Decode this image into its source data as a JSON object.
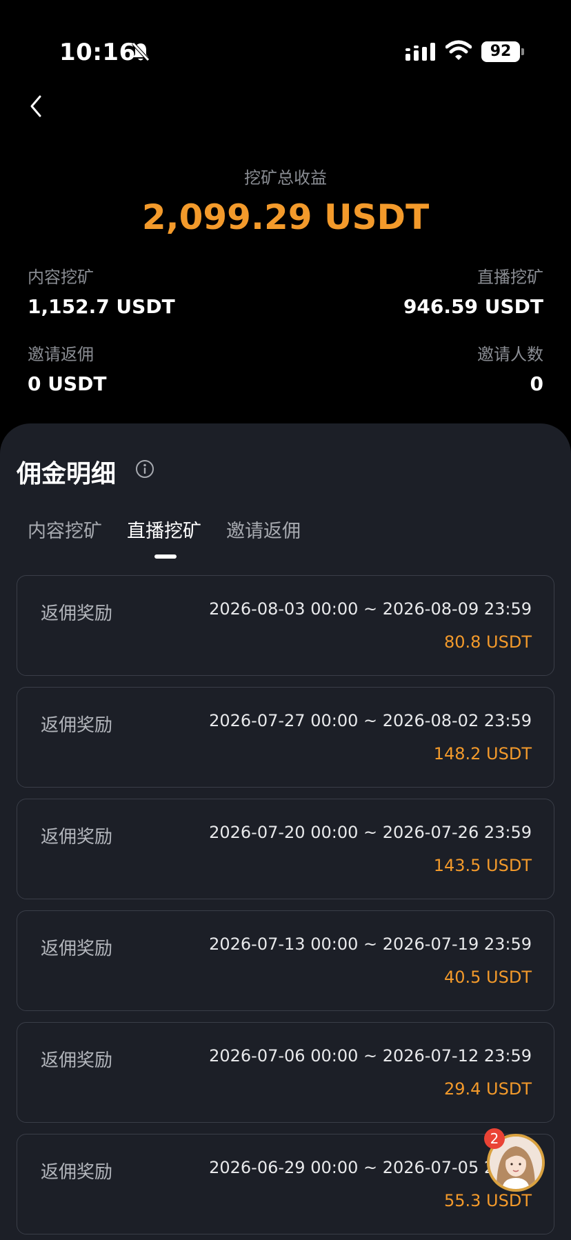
{
  "status_bar": {
    "time": "10:16",
    "battery": "92",
    "icons": [
      "bell-slash-icon",
      "signal-icon",
      "wifi-icon",
      "battery-icon"
    ]
  },
  "summary": {
    "label": "挖矿总收益",
    "total": "2,099.29 USDT",
    "stats": [
      {
        "label": "内容挖矿",
        "value": "1,152.7 USDT"
      },
      {
        "label": "直播挖矿",
        "value": "946.59 USDT"
      },
      {
        "label": "邀请返佣",
        "value": "0 USDT"
      },
      {
        "label": "邀请人数",
        "value": "0"
      }
    ]
  },
  "details": {
    "title": "佣金明细",
    "tabs": [
      {
        "label": "内容挖矿",
        "active": false
      },
      {
        "label": "直播挖矿",
        "active": true
      },
      {
        "label": "邀请返佣",
        "active": false
      }
    ],
    "items": [
      {
        "label": "返佣奖励",
        "range": "2026-08-03 00:00 ~ 2026-08-09 23:59",
        "amount": "80.8 USDT"
      },
      {
        "label": "返佣奖励",
        "range": "2026-07-27 00:00 ~ 2026-08-02 23:59",
        "amount": "148.2 USDT"
      },
      {
        "label": "返佣奖励",
        "range": "2026-07-20 00:00 ~ 2026-07-26 23:59",
        "amount": "143.5 USDT"
      },
      {
        "label": "返佣奖励",
        "range": "2026-07-13 00:00 ~ 2026-07-19 23:59",
        "amount": "40.5 USDT"
      },
      {
        "label": "返佣奖励",
        "range": "2026-07-06 00:00 ~ 2026-07-12 23:59",
        "amount": "29.4 USDT"
      },
      {
        "label": "返佣奖励",
        "range": "2026-06-29 00:00 ~ 2026-07-05 23:59",
        "amount": "55.3 USDT"
      }
    ]
  },
  "assistant": {
    "badge": "2"
  },
  "colors": {
    "accent": "#f39a2b",
    "panel": "#1c1f27",
    "badge": "#ea4335"
  }
}
